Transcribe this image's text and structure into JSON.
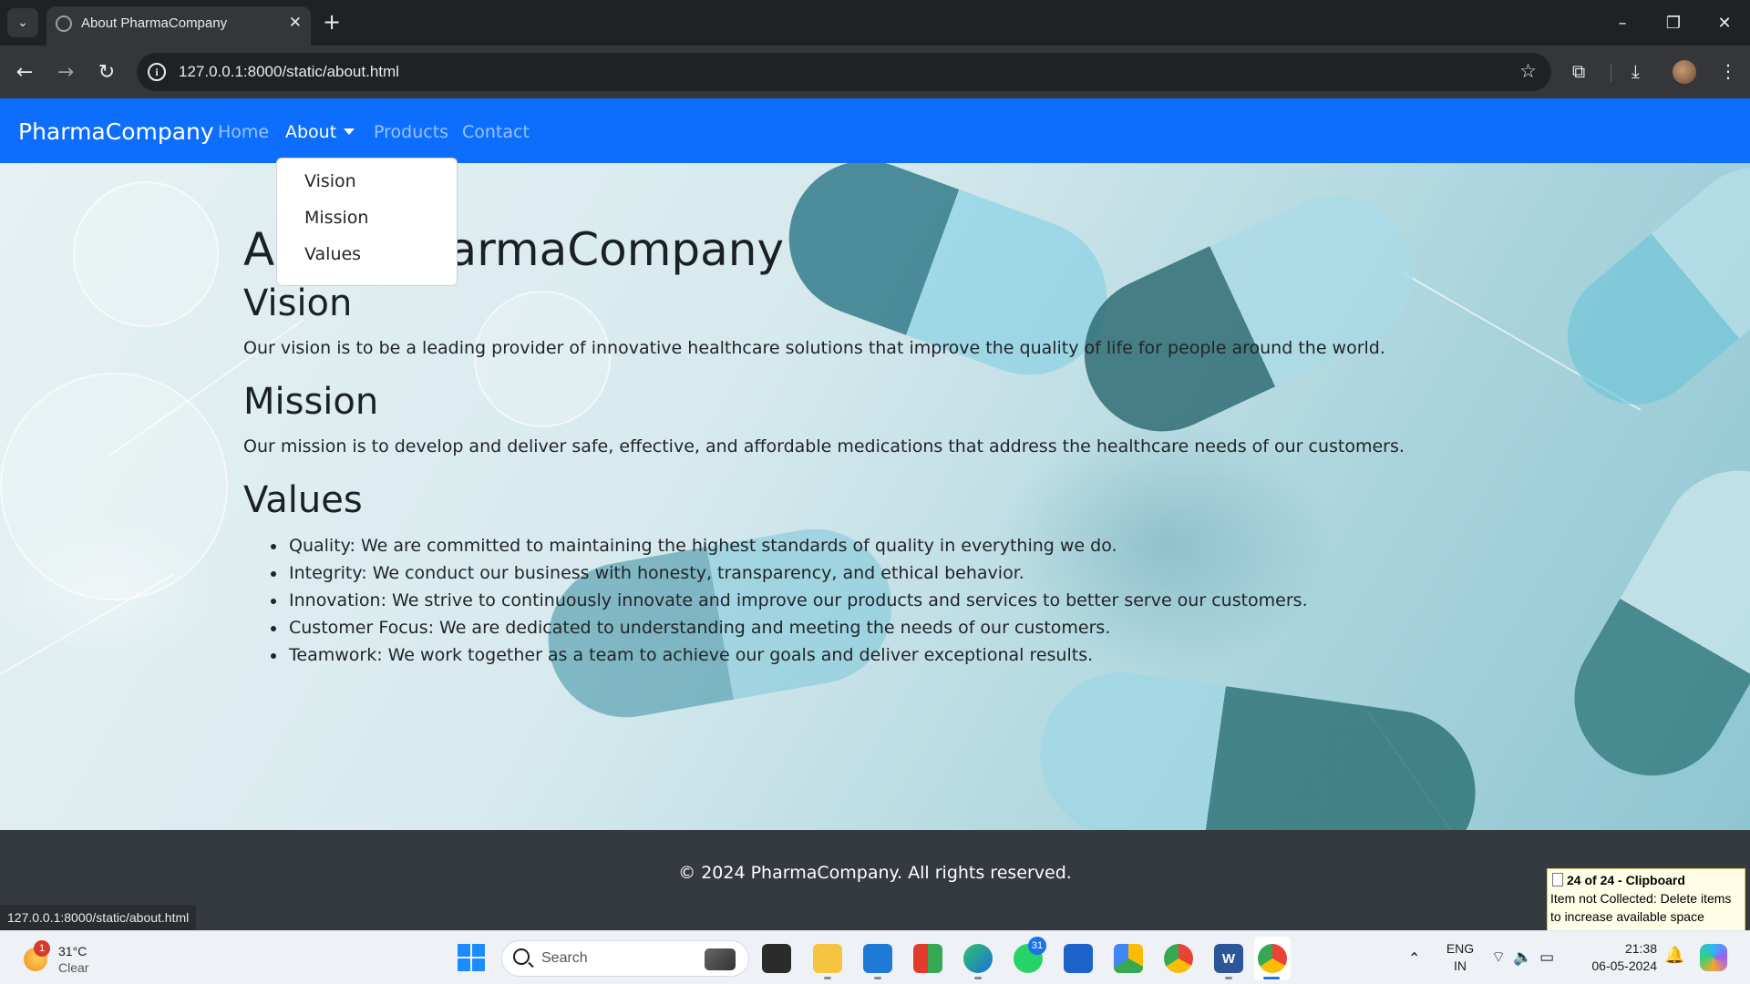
{
  "browser": {
    "tab_title": "About PharmaCompany",
    "tab_close": "✕",
    "new_tab": "+",
    "url": "127.0.0.1:8000/static/about.html",
    "status_url": "127.0.0.1:8000/static/about.html"
  },
  "navbar": {
    "brand": "PharmaCompany",
    "links": [
      {
        "label": "Home"
      },
      {
        "label": "About"
      },
      {
        "label": "Products"
      },
      {
        "label": "Contact"
      }
    ],
    "dropdown": [
      "Vision",
      "Mission",
      "Values"
    ]
  },
  "page": {
    "title": "About PharmaCompany",
    "sections": [
      {
        "heading": "Vision",
        "text": "Our vision is to be a leading provider of innovative healthcare solutions that improve the quality of life for people around the world."
      },
      {
        "heading": "Mission",
        "text": "Our mission is to develop and deliver safe, effective, and affordable medications that address the healthcare needs of our customers."
      },
      {
        "heading": "Values"
      }
    ],
    "values": [
      "Quality: We are committed to maintaining the highest standards of quality in everything we do.",
      "Integrity: We conduct our business with honesty, transparency, and ethical behavior.",
      "Innovation: We strive to continuously innovate and improve our products and services to better serve our customers.",
      "Customer Focus: We are dedicated to understanding and meeting the needs of our customers.",
      "Teamwork: We work together as a team to achieve our goals and deliver exceptional results."
    ]
  },
  "footer": {
    "text": "© 2024 PharmaCompany. All rights reserved."
  },
  "clipboard_popup": {
    "title": "24 of 24 - Clipboard",
    "message": "Item not Collected: Delete items to increase available space"
  },
  "taskbar": {
    "weather_badge": "1",
    "temperature": "31°C",
    "condition": "Clear",
    "search_label": "Search",
    "whatsapp_badge": "31",
    "lang_line1": "ENG",
    "lang_line2": "IN",
    "time": "21:38",
    "date": "06-05-2024"
  },
  "colors": {
    "navbar": "#0d6efd",
    "footer": "#343a40",
    "chrome_dark": "#202124"
  }
}
